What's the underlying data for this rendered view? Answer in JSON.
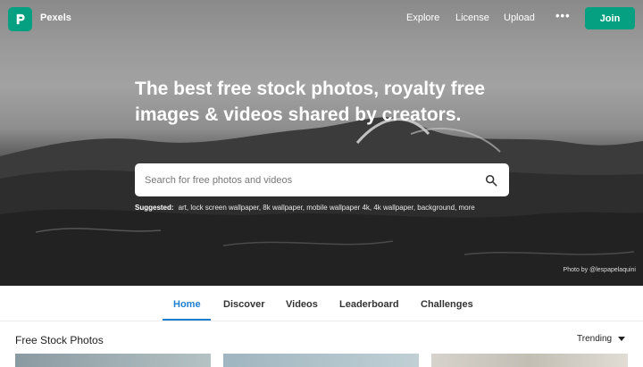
{
  "nav": {
    "brand": "Pexels",
    "links": [
      "Explore",
      "License",
      "Upload"
    ],
    "more_label": "•••",
    "join_label": "Join"
  },
  "hero": {
    "headline": "The best free stock photos, royalty free images & videos shared by creators.",
    "search_placeholder": "Search for free photos and videos",
    "suggested_label": "Suggested:",
    "suggested_terms": "art, lock screen wallpaper, 8k wallpaper, mobile wallpaper 4k, 4k wallpaper, background, more",
    "photo_credit": "Photo by @lespapelaquini"
  },
  "tabs": [
    "Home",
    "Discover",
    "Videos",
    "Leaderboard",
    "Challenges"
  ],
  "active_tab": "Home",
  "section": {
    "title": "Free Stock Photos",
    "sort_label": "Trending"
  },
  "colors": {
    "brand_green": "#05a081",
    "active_tab_blue": "#1f7fd0"
  },
  "icons": [
    "pexels-logo-icon",
    "search-icon",
    "caret-down-icon"
  ]
}
